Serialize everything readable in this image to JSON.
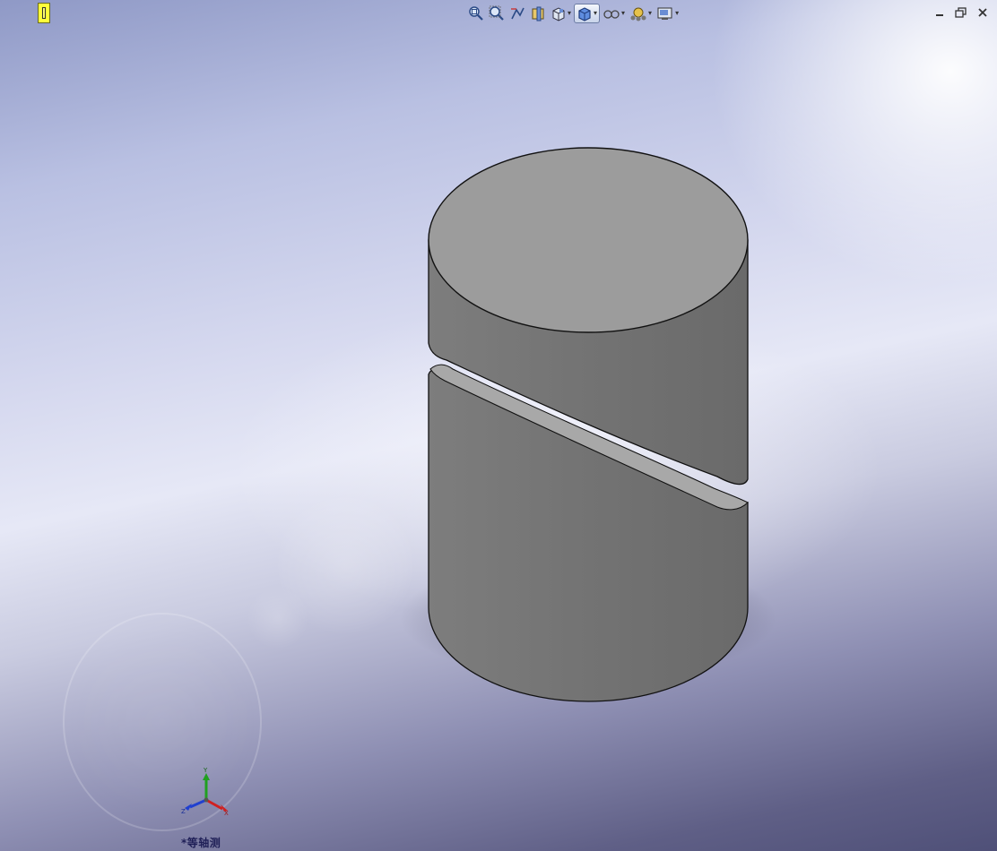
{
  "viewport": {
    "view_orientation_label": "*等轴测",
    "triad": {
      "x_label": "X",
      "y_label": "Y",
      "z_label": "Z"
    }
  },
  "toolbar": {
    "items": [
      {
        "name": "zoom-to-fit-icon"
      },
      {
        "name": "zoom-to-area-icon"
      },
      {
        "name": "previous-view-icon"
      },
      {
        "name": "section-view-icon"
      },
      {
        "name": "view-orientation-icon",
        "dropdown": true
      },
      {
        "name": "display-style-icon",
        "dropdown": true,
        "active": true
      },
      {
        "name": "hide-show-items-icon",
        "dropdown": true
      },
      {
        "name": "edit-appearance-icon",
        "dropdown": true
      },
      {
        "name": "apply-scene-icon",
        "dropdown": true
      }
    ]
  },
  "window_controls": [
    "minimize-icon",
    "restore-icon",
    "close-icon"
  ],
  "colors": {
    "model_top": "#9c9c9c",
    "model_side": "#727272",
    "model_edge": "#111111",
    "triad_x": "#d02020",
    "triad_y": "#20a020",
    "triad_z": "#2040d0"
  }
}
